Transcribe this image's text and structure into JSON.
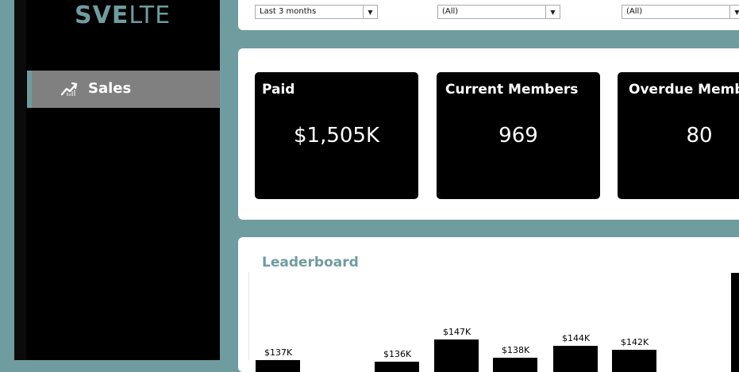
{
  "sidebar": {
    "logo_bold": "SVE",
    "logo_light": "LTE",
    "nav_items": [
      {
        "label": "Sales",
        "icon": "trend-chart-icon",
        "active": true
      }
    ]
  },
  "filters": [
    {
      "value": "Last 3 months"
    },
    {
      "value": "(All)"
    },
    {
      "value": "(All)"
    }
  ],
  "kpis": [
    {
      "title": "Paid",
      "value": "$1,505K"
    },
    {
      "title": "Current Members",
      "value": "969"
    },
    {
      "title": "Overdue Members",
      "value": "80"
    }
  ],
  "leaderboard": {
    "title": "Leaderboard",
    "chart_data": {
      "type": "bar",
      "value_labels": [
        "$137K",
        "$136K",
        "$147K",
        "$138K",
        "$144K",
        "$142K",
        ""
      ],
      "values": [
        137,
        136,
        147,
        138,
        144,
        142,
        180
      ]
    }
  },
  "colors": {
    "accent": "#6f9c9f",
    "sidebar_bg": "#000000",
    "nav_active_bg": "#808080",
    "card_bg": "#000000"
  }
}
